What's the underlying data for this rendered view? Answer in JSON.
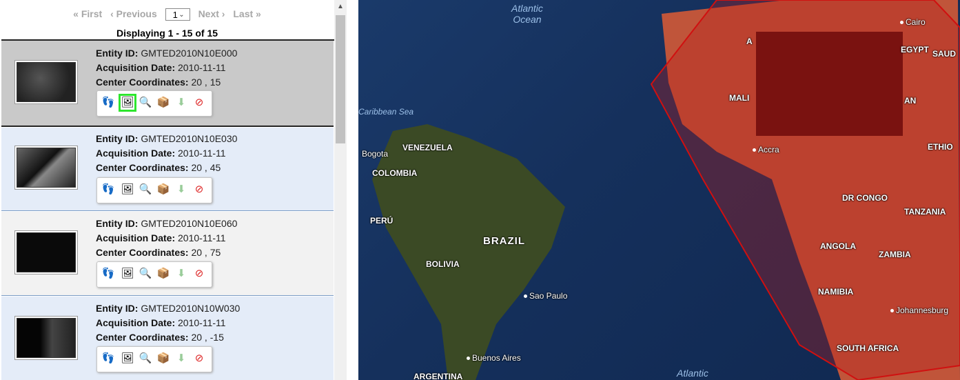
{
  "pager": {
    "first": "« First",
    "previous": "‹ Previous",
    "page_value": "1",
    "next": "Next ›",
    "last": "Last »"
  },
  "count_text": "Displaying 1 - 15 of 15",
  "labels": {
    "entity": "Entity ID:",
    "date": "Acquisition Date:",
    "coords": "Center Coordinates:"
  },
  "results": [
    {
      "entity_id": "GMTED2010N10E000",
      "date": "2010-11-11",
      "coords": "20 , 15"
    },
    {
      "entity_id": "GMTED2010N10E030",
      "date": "2010-11-11",
      "coords": "20 , 45"
    },
    {
      "entity_id": "GMTED2010N10E060",
      "date": "2010-11-11",
      "coords": "20 , 75"
    },
    {
      "entity_id": "GMTED2010N10W030",
      "date": "2010-11-11",
      "coords": "20 , -15"
    }
  ],
  "tool_icons": [
    "footprint-icon",
    "overlay-icon",
    "metadata-icon",
    "order-icon",
    "download-icon",
    "exclude-icon"
  ],
  "map": {
    "ocean_labels": [
      "Atlantic\nOcean",
      "Caribbean Sea",
      "Atlantic"
    ],
    "countries": [
      "VENEZUELA",
      "COLOMBIA",
      "PERÚ",
      "BRAZIL",
      "BOLIVIA",
      "ARGENTINA",
      "MALI",
      "DR CONGO",
      "TANZANIA",
      "ANGOLA",
      "ZAMBIA",
      "NAMIBIA",
      "SOUTH AFRICA",
      "ETHIO",
      "SAUD",
      "AN",
      "EGYPT",
      "A"
    ],
    "cities": [
      "Bogota",
      "Sao Paulo",
      "Buenos Aires",
      "Accra",
      "Cairo",
      "Johannesburg"
    ]
  },
  "colors": {
    "selected": "#c9c9c9",
    "alt": "#e4ecf8",
    "footprint": "#b41e1e"
  }
}
